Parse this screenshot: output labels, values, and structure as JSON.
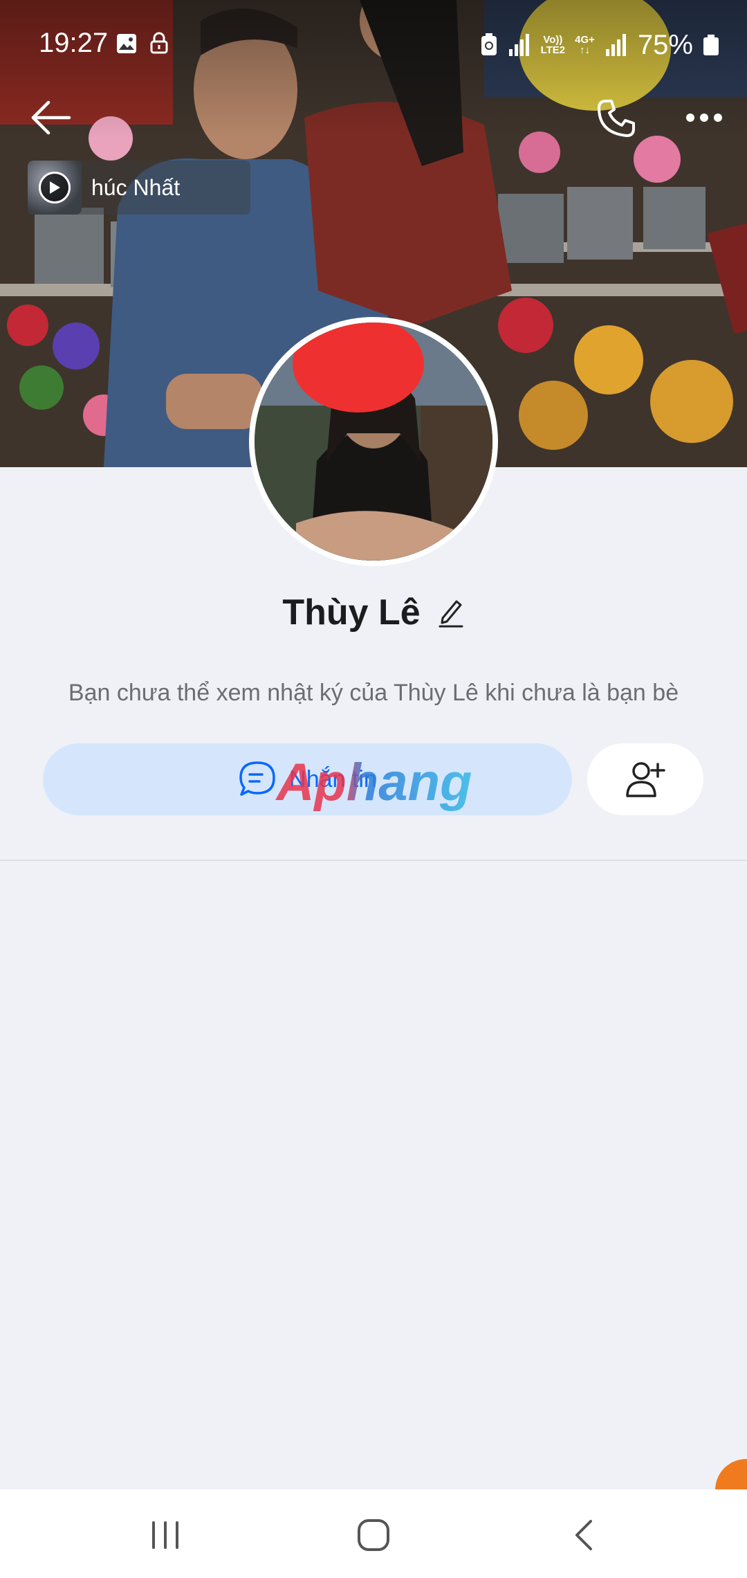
{
  "status_bar": {
    "time": "19:27",
    "network_top": "Vo))",
    "network_bottom": "LTE2",
    "data_type": "4G+",
    "battery": "75%"
  },
  "music": {
    "title": "húc Nhất"
  },
  "profile": {
    "name": "Thùy Lê",
    "info": "Bạn chưa thể xem nhật ký của Thùy Lê khi chưa là bạn bè"
  },
  "actions": {
    "message_label": "Nhắn tin"
  },
  "watermark": {
    "text": "Aphang"
  },
  "colors": {
    "accent": "#0a68ff",
    "message_button_bg": "#d5e6fc",
    "page_bg": "#eff1f6",
    "badge": "#f07b1f"
  },
  "icons": [
    "image-icon",
    "lock-icon",
    "back-arrow-icon",
    "phone-icon",
    "more-icon",
    "play-icon",
    "edit-icon",
    "chat-icon",
    "add-friend-icon",
    "recents-icon",
    "home-icon",
    "nav-back-icon"
  ]
}
